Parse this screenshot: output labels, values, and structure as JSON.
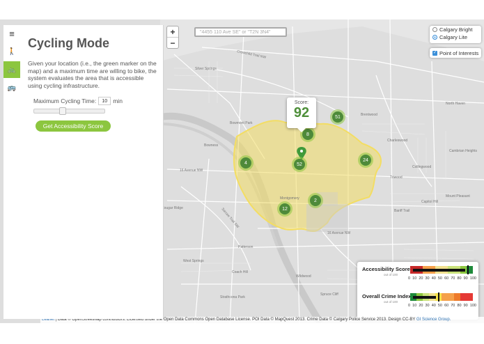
{
  "panel": {
    "title": "Cycling Mode",
    "description": "Given your location (i.e., the green marker on the map) and a maximum time are willing to bike, the system evaluates the area that is accessible using cycling infrastructure.",
    "time_label": "Maximum Cycling Time:",
    "time_value": "10",
    "time_unit": "min",
    "button_label": "Get Accessibility Score",
    "slider_fraction": 0.4
  },
  "rail": {
    "items": [
      {
        "icon": "menu-icon",
        "glyph": "≡"
      },
      {
        "icon": "walk-icon",
        "glyph": "🚶"
      },
      {
        "icon": "bike-icon",
        "glyph": "🚲"
      },
      {
        "icon": "bus-icon",
        "glyph": "🚌"
      }
    ],
    "active_color": "#8cc63f"
  },
  "map": {
    "zoom_in": "+",
    "zoom_out": "−",
    "search_placeholder": "\"4455 110 Ave SE\" or \"T2N 3N4\"",
    "layers": {
      "option1": "Calgary Bright",
      "option2": "Calgary Lite",
      "selected": "Calgary Lite"
    },
    "poi_label": "Point of Interests",
    "score": {
      "label": "Score:",
      "value": "92"
    },
    "clusters": [
      "51",
      "8",
      "4",
      "52",
      "24",
      "2",
      "12"
    ],
    "labels": {
      "silver_springs": "Silver Springs",
      "bowness": "Bowness",
      "bowmont": "Bowmont Park",
      "north_haven": "North Haven",
      "brentwood": "Brentwood",
      "charleswood": "Charleswood",
      "cambrian": "Cambrian Heights",
      "collingwood": "Collingwood",
      "triwood": "Triwood",
      "banff_trail": "Banff Trail",
      "capitol_hill": "Capitol Hill",
      "mount_pleasant": "Mount Pleasant",
      "montgomery": "Montgomery",
      "patterson": "Patterson",
      "west_springs": "West Springs",
      "coach_hill": "Coach Hill",
      "wildwood": "Wildwood",
      "strathcona": "Strathcona Park",
      "spruce_cliff": "Spruce Cliff",
      "cougar": "Cougar Ridge",
      "ave16": "16 Avenue NW",
      "ave16b": "16 Avenue NW",
      "sarcee": "Sarcee Trail SW",
      "crowchild": "Crowchild Trail NW"
    },
    "polygon_color": "#f3dd63"
  },
  "legend": {
    "accessibility": {
      "title": "Accessibility Score",
      "subtitle": "out of 100",
      "value": 92
    },
    "crime": {
      "title": "Overall Crime Index",
      "subtitle": "out of 100",
      "value": 45
    },
    "ticks": [
      "0",
      "10",
      "20",
      "30",
      "40",
      "50",
      "60",
      "70",
      "80",
      "90",
      "100"
    ],
    "accessibility_colors": [
      "#c62828",
      "#c62828",
      "#f5a04a",
      "#f5a04a",
      "#f1e08e",
      "#f1e08e",
      "#c9e27a",
      "#c9e27a",
      "#8cc63f",
      "#1e8a3a"
    ],
    "crime_colors": [
      "#1e8a3a",
      "#8cc63f",
      "#c9e27a",
      "#f1e08e",
      "#f5e24a",
      "#f5a04a",
      "#f5a04a",
      "#ee7a2a",
      "#e53935",
      "#e53935"
    ]
  },
  "attribution": {
    "leaflet": "Leaflet",
    "text": " | Data © OpenStreetMap contributors. Licensed under the Open Data Commons Open Database License. POI Data © MapQuest 2013. Crime Data © Calgary Police Service 2013. Design CC-BY ",
    "group": "GI Science Group."
  }
}
